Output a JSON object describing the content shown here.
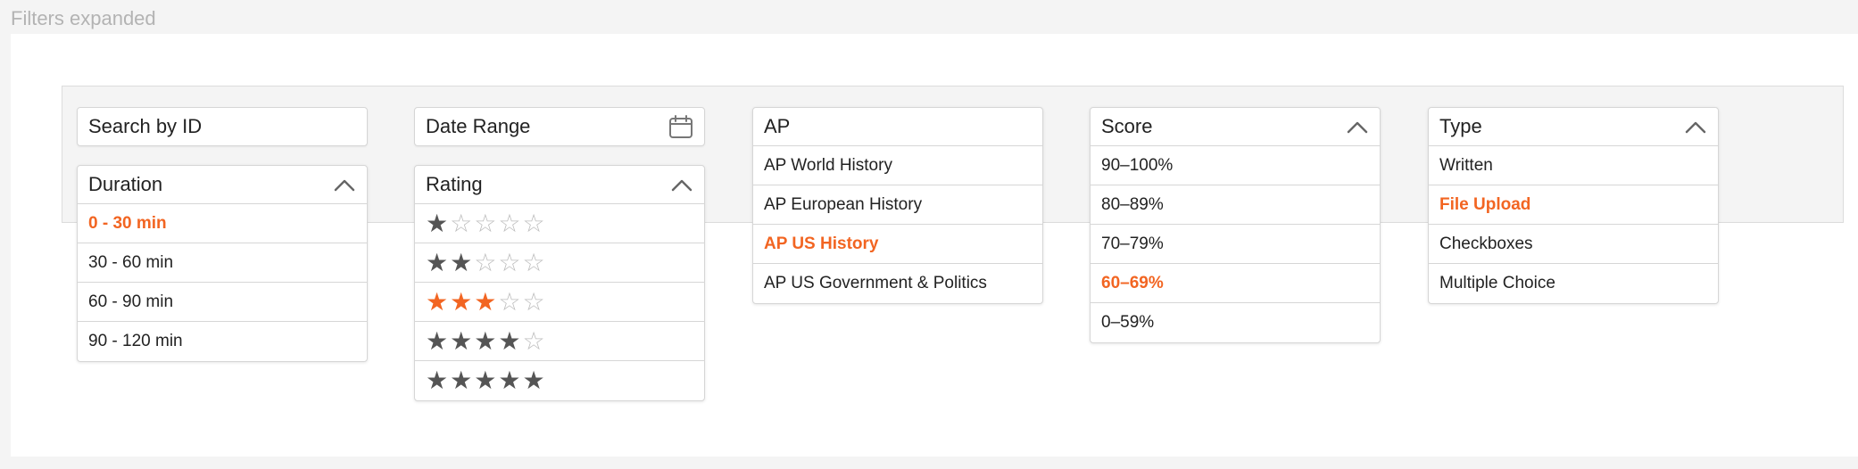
{
  "caption": "Filters expanded",
  "colors": {
    "accent": "#f26522",
    "border": "#d6d6d6",
    "star_on": "#555555",
    "star_off": "#bdbdbd"
  },
  "search": {
    "placeholder": "Search by ID"
  },
  "date_range": {
    "label": "Date Range",
    "icon": "calendar-icon"
  },
  "duration": {
    "label": "Duration",
    "icon": "chevron-up-icon",
    "options": [
      "0 - 30 min",
      "30 - 60 min",
      "60 - 90 min",
      "90 - 120 min"
    ],
    "selected_index": 0
  },
  "rating": {
    "label": "Rating",
    "icon": "chevron-up-icon",
    "options": [
      {
        "filled": 1,
        "total": 5
      },
      {
        "filled": 2,
        "total": 5
      },
      {
        "filled": 3,
        "total": 5
      },
      {
        "filled": 4,
        "total": 5
      },
      {
        "filled": 5,
        "total": 5
      }
    ],
    "selected_index": 2
  },
  "ap": {
    "label": "AP",
    "options": [
      "AP World History",
      "AP European History",
      "AP US History",
      "AP US Government & Politics"
    ],
    "selected_index": 2
  },
  "score": {
    "label": "Score",
    "icon": "chevron-up-icon",
    "options": [
      "90–100%",
      "80–89%",
      "70–79%",
      "60–69%",
      "0–59%"
    ],
    "selected_index": 3
  },
  "type": {
    "label": "Type",
    "icon": "chevron-up-icon",
    "options": [
      "Written",
      "File Upload",
      "Checkboxes",
      "Multiple Choice"
    ],
    "selected_index": 1
  }
}
